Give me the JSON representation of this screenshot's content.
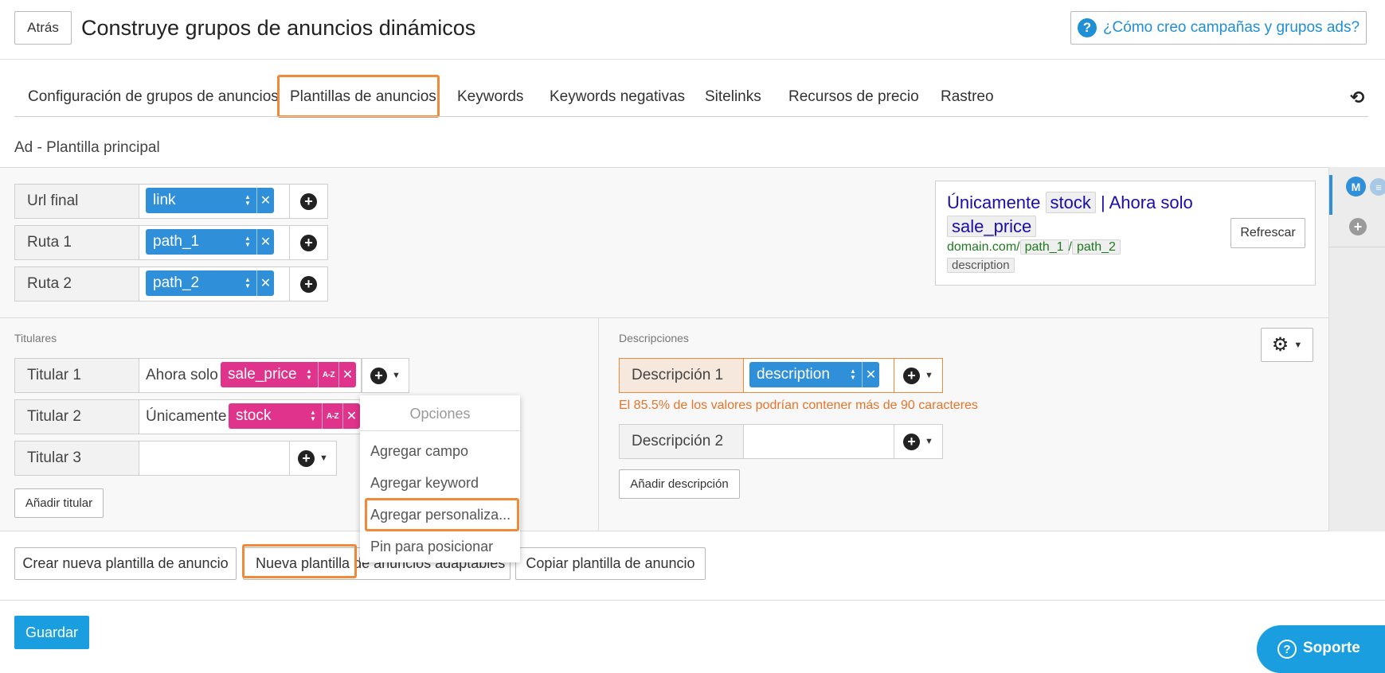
{
  "header": {
    "back_label": "Atrás",
    "title": "Construye grupos de anuncios dinámicos",
    "help_label": "¿Cómo creo campañas y grupos ads?"
  },
  "tabs": [
    {
      "label": "Configuración de grupos de anuncios"
    },
    {
      "label": "Plantillas de anuncios",
      "active": true
    },
    {
      "label": "Keywords"
    },
    {
      "label": "Keywords negativas"
    },
    {
      "label": "Sitelinks"
    },
    {
      "label": "Recursos de precio"
    },
    {
      "label": "Rastreo"
    }
  ],
  "section_title": "Ad - Plantilla principal",
  "url_rows": [
    {
      "label": "Url final",
      "value": "link"
    },
    {
      "label": "Ruta 1",
      "value": "path_1"
    },
    {
      "label": "Ruta 2",
      "value": "path_2"
    }
  ],
  "preview": {
    "line1_a": "Únicamente",
    "line1_tag": "stock",
    "line1_b": "| Ahora solo",
    "line2_tag": "sale_price",
    "domain": "domain.com/",
    "path1": "path_1",
    "slash": "/",
    "path2": "path_2",
    "description": "description",
    "refresh_label": "Refrescar"
  },
  "side_panel": {
    "avatar_letter": "M"
  },
  "headlines": {
    "section_label": "Titulares",
    "rows": [
      {
        "label": "Titular 1",
        "text": "Ahora solo",
        "tag": "sale_price"
      },
      {
        "label": "Titular 2",
        "text": "Únicamente",
        "tag": "stock"
      },
      {
        "label": "Titular 3",
        "text": "",
        "tag": ""
      }
    ],
    "add_label": "Añadir titular",
    "az_label": "A-Z"
  },
  "descriptions": {
    "section_label": "Descripciones",
    "rows": [
      {
        "label": "Descripción 1",
        "tag": "description"
      },
      {
        "label": "Descripción 2",
        "tag": ""
      }
    ],
    "warning": "El 85.5% de los valores podrían contener más de 90 caracteres",
    "add_label": "Añadir descripción"
  },
  "dropdown": {
    "title": "Opciones",
    "items": [
      "Agregar campo",
      "Agregar keyword",
      "Agregar personaliza...",
      "Pin para posicionar"
    ]
  },
  "footer_buttons": {
    "create": "Crear nueva plantilla de anuncio",
    "adaptive": "Nueva plantilla de anuncios adaptables",
    "copy": "Copiar plantilla de anuncio"
  },
  "save_label": "Guardar",
  "support_label": "Soporte",
  "colors": {
    "accent_blue": "#2f8fd8",
    "accent_pink": "#e0338b",
    "highlight_orange": "#f08a3a",
    "save_blue": "#1a9ee0"
  }
}
